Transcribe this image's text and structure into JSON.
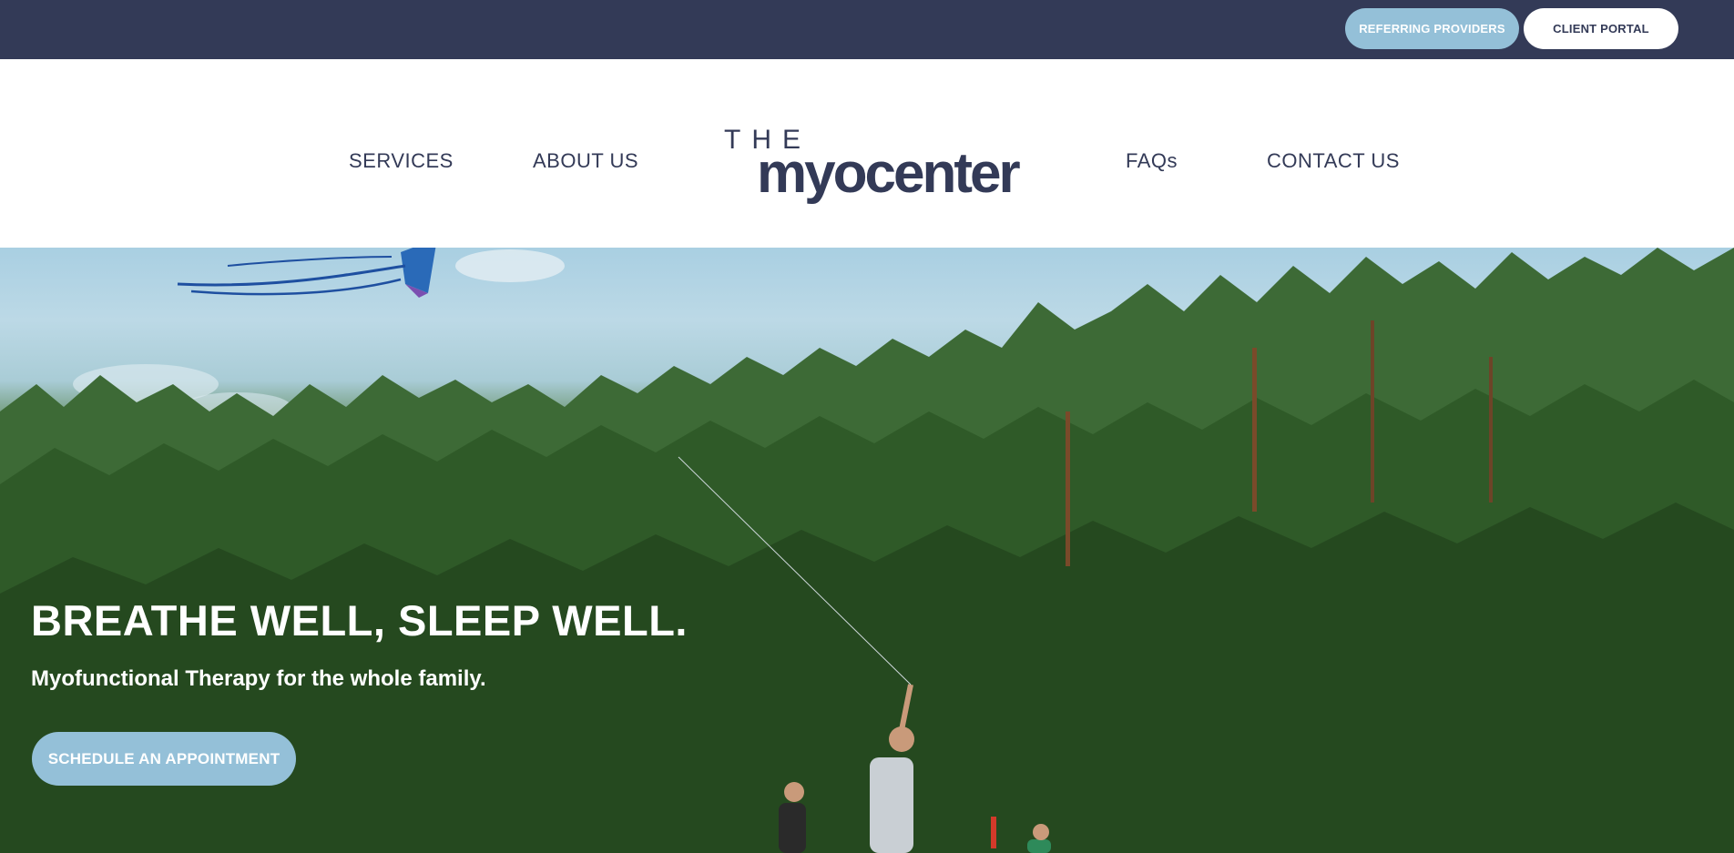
{
  "topbar": {
    "referring_label": "REFERRING PROVIDERS",
    "portal_label": "CLIENT PORTAL",
    "background_color": "#333a57",
    "accent_color": "#94c0d8"
  },
  "nav": {
    "items": [
      {
        "label": "SERVICES"
      },
      {
        "label": "ABOUT US"
      },
      {
        "label": "FAQs"
      },
      {
        "label": "CONTACT US"
      }
    ]
  },
  "logo": {
    "the": "THE",
    "wordmark": "myocenter"
  },
  "hero": {
    "title": "BREATHE WELL, SLEEP WELL.",
    "subtitle": "Myofunctional Therapy for the whole family.",
    "cta_label": "SCHEDULE AN APPOINTMENT",
    "image_description_icon": "forest-kite-family-photo"
  }
}
